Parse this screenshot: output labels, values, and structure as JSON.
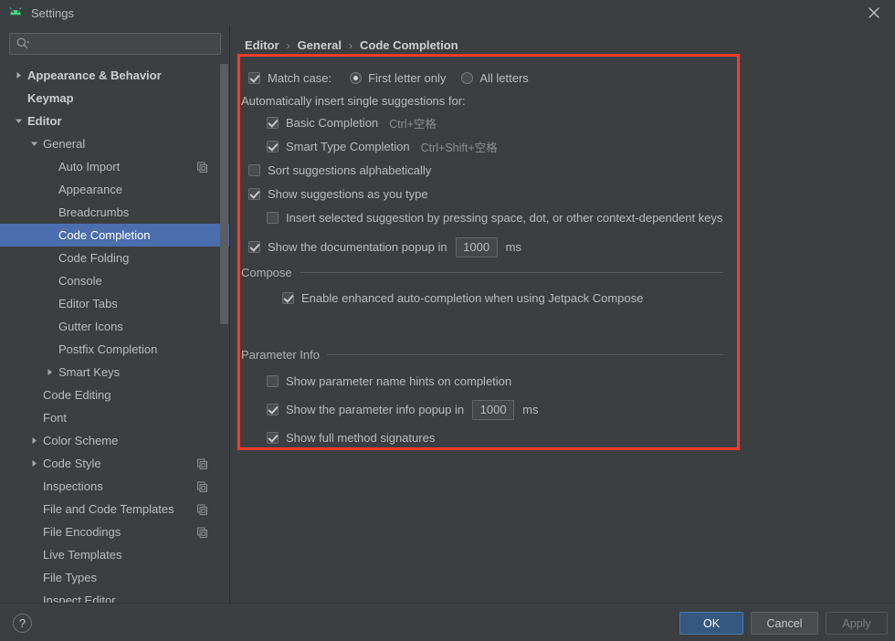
{
  "window": {
    "title": "Settings",
    "app_icon": "android-icon",
    "close_icon": "close-icon"
  },
  "search": {
    "value": "",
    "placeholder": "",
    "icon": "search-icon"
  },
  "sidebar": {
    "items": [
      {
        "label": "Appearance & Behavior",
        "indent": 0,
        "arrow": "right",
        "bold": true,
        "selected": false,
        "copy": false
      },
      {
        "label": "Keymap",
        "indent": 0,
        "arrow": "none",
        "bold": true,
        "selected": false,
        "copy": false
      },
      {
        "label": "Editor",
        "indent": 0,
        "arrow": "down",
        "bold": true,
        "selected": false,
        "copy": false
      },
      {
        "label": "General",
        "indent": 1,
        "arrow": "down",
        "bold": false,
        "selected": false,
        "copy": false
      },
      {
        "label": "Auto Import",
        "indent": 2,
        "arrow": "none",
        "bold": false,
        "selected": false,
        "copy": true
      },
      {
        "label": "Appearance",
        "indent": 2,
        "arrow": "none",
        "bold": false,
        "selected": false,
        "copy": false
      },
      {
        "label": "Breadcrumbs",
        "indent": 2,
        "arrow": "none",
        "bold": false,
        "selected": false,
        "copy": false
      },
      {
        "label": "Code Completion",
        "indent": 2,
        "arrow": "none",
        "bold": false,
        "selected": true,
        "copy": false
      },
      {
        "label": "Code Folding",
        "indent": 2,
        "arrow": "none",
        "bold": false,
        "selected": false,
        "copy": false
      },
      {
        "label": "Console",
        "indent": 2,
        "arrow": "none",
        "bold": false,
        "selected": false,
        "copy": false
      },
      {
        "label": "Editor Tabs",
        "indent": 2,
        "arrow": "none",
        "bold": false,
        "selected": false,
        "copy": false
      },
      {
        "label": "Gutter Icons",
        "indent": 2,
        "arrow": "none",
        "bold": false,
        "selected": false,
        "copy": false
      },
      {
        "label": "Postfix Completion",
        "indent": 2,
        "arrow": "none",
        "bold": false,
        "selected": false,
        "copy": false
      },
      {
        "label": "Smart Keys",
        "indent": 2,
        "arrow": "right",
        "bold": false,
        "selected": false,
        "copy": false
      },
      {
        "label": "Code Editing",
        "indent": 1,
        "arrow": "none",
        "bold": false,
        "selected": false,
        "copy": false
      },
      {
        "label": "Font",
        "indent": 1,
        "arrow": "none",
        "bold": false,
        "selected": false,
        "copy": false
      },
      {
        "label": "Color Scheme",
        "indent": 1,
        "arrow": "right",
        "bold": false,
        "selected": false,
        "copy": false
      },
      {
        "label": "Code Style",
        "indent": 1,
        "arrow": "right",
        "bold": false,
        "selected": false,
        "copy": true
      },
      {
        "label": "Inspections",
        "indent": 1,
        "arrow": "none",
        "bold": false,
        "selected": false,
        "copy": true
      },
      {
        "label": "File and Code Templates",
        "indent": 1,
        "arrow": "none",
        "bold": false,
        "selected": false,
        "copy": true
      },
      {
        "label": "File Encodings",
        "indent": 1,
        "arrow": "none",
        "bold": false,
        "selected": false,
        "copy": true
      },
      {
        "label": "Live Templates",
        "indent": 1,
        "arrow": "none",
        "bold": false,
        "selected": false,
        "copy": false
      },
      {
        "label": "File Types",
        "indent": 1,
        "arrow": "none",
        "bold": false,
        "selected": false,
        "copy": false
      },
      {
        "label": "Inspect Editor",
        "indent": 1,
        "arrow": "none",
        "bold": false,
        "selected": false,
        "copy": false
      }
    ]
  },
  "breadcrumb": {
    "items": [
      "Editor",
      "General",
      "Code Completion"
    ],
    "separator": "›"
  },
  "settings": {
    "match_case": {
      "label": "Match case:",
      "checked": true,
      "options": [
        {
          "label": "First letter only",
          "selected": true
        },
        {
          "label": "All letters",
          "selected": false
        }
      ]
    },
    "auto_insert_header": "Automatically insert single suggestions for:",
    "basic_completion": {
      "label": "Basic Completion",
      "checked": true,
      "shortcut": "Ctrl+空格"
    },
    "smart_type_completion": {
      "label": "Smart Type Completion",
      "checked": true,
      "shortcut": "Ctrl+Shift+空格"
    },
    "sort_alphabetically": {
      "label": "Sort suggestions alphabetically",
      "checked": false
    },
    "show_as_you_type": {
      "label": "Show suggestions as you type",
      "checked": true
    },
    "insert_selected": {
      "label": "Insert selected suggestion by pressing space, dot, or other context-dependent keys",
      "checked": false
    },
    "doc_popup": {
      "label": "Show the documentation popup in",
      "checked": true,
      "value": "1000",
      "unit": "ms"
    },
    "compose_section": "Compose",
    "compose_enable": {
      "label": "Enable enhanced auto-completion when using Jetpack Compose",
      "checked": true
    },
    "parameter_section": "Parameter Info",
    "param_name_hints": {
      "label": "Show parameter name hints on completion",
      "checked": false
    },
    "param_info_popup": {
      "label": "Show the parameter info popup in",
      "checked": true,
      "value": "1000",
      "unit": "ms"
    },
    "full_signatures": {
      "label": "Show full method signatures",
      "checked": true
    }
  },
  "footer": {
    "help_label": "?",
    "ok_label": "OK",
    "cancel_label": "Cancel",
    "apply_label": "Apply"
  },
  "colors": {
    "background": "#3c3f41",
    "selection": "#4b6eaf",
    "highlight_border": "#ff3b30",
    "ok_button": "#365880",
    "brand_green": "#3ddc84"
  }
}
